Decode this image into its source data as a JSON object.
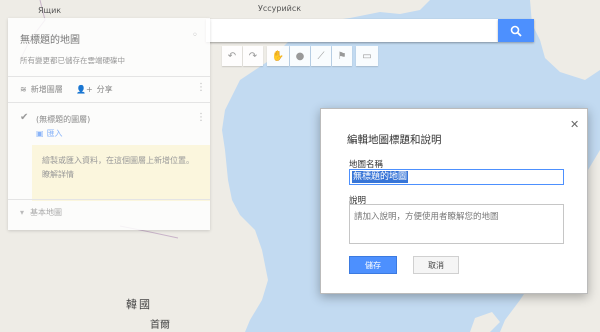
{
  "colors": {
    "water": "#c2daf1",
    "land": "#eeece6",
    "accent": "#4d90fe"
  },
  "map": {
    "labels": {
      "top_left": "Ящик",
      "top_center": "Уссурийск",
      "korea": "韓國",
      "seoul": "首爾"
    }
  },
  "search": {
    "placeholder": "",
    "button_icon": "search-icon"
  },
  "toolbar": {
    "icons": [
      "undo-icon",
      "redo-icon",
      "hand-icon",
      "marker-icon",
      "line-icon",
      "directions-icon",
      "ruler-icon"
    ]
  },
  "panel": {
    "title": "無標題的地圖",
    "subtitle": "所有變更都已儲存在雲端硬碟中",
    "add_layer": "新增圖層",
    "share": "分享",
    "layer_name": "(無標題的圖層)",
    "import": "匯入",
    "layer_hint": "繪製或匯入資料，在這個圖層上新增位置。 瞭解詳情",
    "basemap": "基本地圖"
  },
  "dialog": {
    "title": "編輯地圖標題和說明",
    "title_label": "地圖名稱",
    "title_value": "無標題的地圖",
    "desc_label": "說明",
    "desc_placeholder": "請加入說明，方便使用者瞭解您的地圖",
    "save": "儲存",
    "cancel": "取消"
  }
}
